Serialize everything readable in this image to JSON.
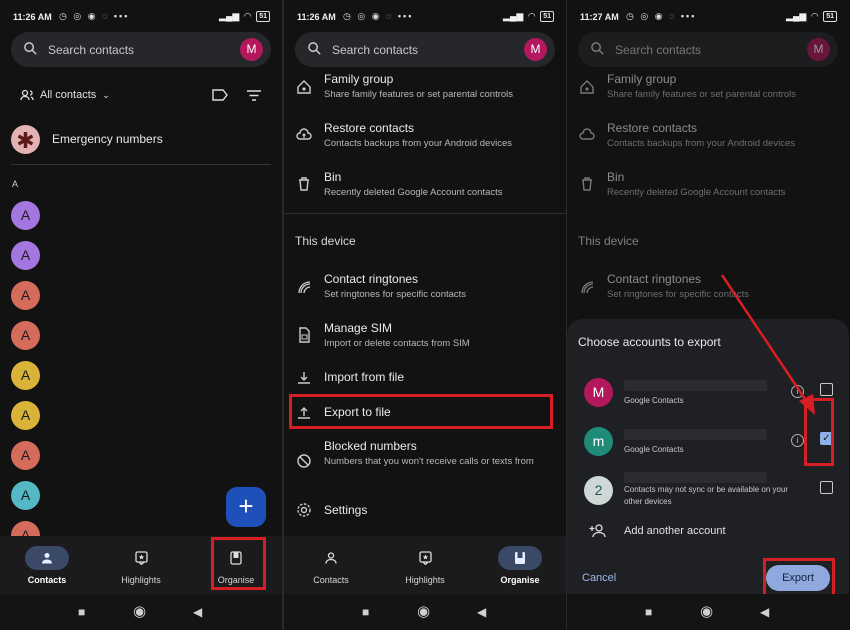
{
  "status": {
    "p1_time": "11:26 AM",
    "p2_time": "11:26 AM",
    "p3_time": "11:27 AM",
    "battery": "51"
  },
  "search": {
    "placeholder": "Search contacts",
    "avatar_letter": "M"
  },
  "panel1": {
    "filter_label": "All contacts",
    "emergency_label": "Emergency numbers",
    "section_letter": "A",
    "contacts": [
      {
        "letter": "A",
        "color": "#a476e0"
      },
      {
        "letter": "A",
        "color": "#a476e0"
      },
      {
        "letter": "A",
        "color": "#d46b5b"
      },
      {
        "letter": "A",
        "color": "#d46b5b"
      },
      {
        "letter": "A",
        "color": "#d9b338"
      },
      {
        "letter": "A",
        "color": "#d9b338"
      },
      {
        "letter": "A",
        "color": "#d46b5b"
      },
      {
        "letter": "A",
        "color": "#54b8c5"
      },
      {
        "letter": "A",
        "color": "#d46b5b"
      }
    ],
    "fab_label": "+"
  },
  "nav": {
    "contacts": "Contacts",
    "highlights": "Highlights",
    "organise": "Organise"
  },
  "menu": {
    "family_group": {
      "title": "Family group",
      "sub": "Share family features or set parental controls"
    },
    "restore": {
      "title": "Restore contacts",
      "sub": "Contacts backups from your Android devices"
    },
    "bin": {
      "title": "Bin",
      "sub": "Recently deleted Google Account contacts"
    },
    "this_device": "This device",
    "ringtones": {
      "title": "Contact ringtones",
      "sub": "Set ringtones for specific contacts"
    },
    "manage_sim": {
      "title": "Manage SIM",
      "sub": "Import or delete contacts from SIM"
    },
    "import_file": {
      "title": "Import from file"
    },
    "export_file": {
      "title": "Export to file"
    },
    "blocked": {
      "title": "Blocked numbers",
      "sub": "Numbers that you won't receive calls or texts from"
    },
    "settings": {
      "title": "Settings"
    }
  },
  "sheet": {
    "title": "Choose accounts to export",
    "accounts": [
      {
        "letter": "M",
        "color": "#b3175d",
        "sub": "Google Contacts",
        "checked": false
      },
      {
        "letter": "m",
        "color": "#1f8c7a",
        "sub": "Google Contacts",
        "checked": true
      },
      {
        "letter": "2",
        "color": "#cfd8d6",
        "sub": "Contacts may not sync or be available on your other devices",
        "checked": false
      }
    ],
    "add_account": "Add another account",
    "cancel": "Cancel",
    "export": "Export"
  },
  "colors": {
    "highlight_red": "#d81e25",
    "fab_blue": "#1f4fb8",
    "accent_blue": "#8fa9de"
  }
}
